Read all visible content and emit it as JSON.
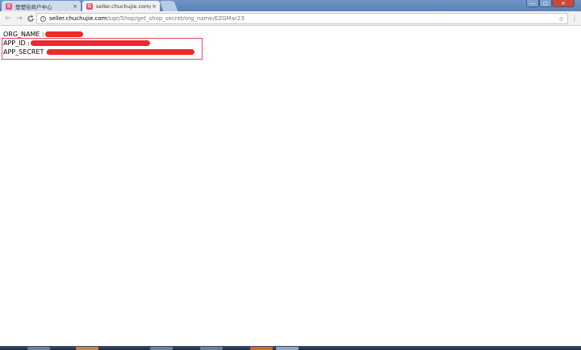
{
  "browser": {
    "tabs": [
      {
        "title": "楚楚街商户中心",
        "favicon_color": "#e84c7a",
        "favicon_glyph": "楚",
        "active": false
      },
      {
        "title": "seller.chuchujie.com/sc",
        "favicon_color": "#e84c7a",
        "favicon_glyph": "楚",
        "active": true
      }
    ],
    "close_glyph": "×",
    "window_controls": {
      "min": "—",
      "max": "□",
      "close": "✕"
    },
    "nav": {
      "back": "←",
      "forward": "→",
      "reload": "C"
    },
    "url_host": "seller.chuchujie.com",
    "url_path": "/sqe/Shop/get_shop_secret/org_name/EZGMar23",
    "star": "☆",
    "menu": "⋮"
  },
  "page": {
    "org_name_label": "ORG_NAME :",
    "app_id_label": "APP_ID :",
    "app_secret_label": "APP_SECRET :"
  },
  "colors": {
    "redaction": "#ee2a2a",
    "highlight_border": "#e24a5a"
  }
}
